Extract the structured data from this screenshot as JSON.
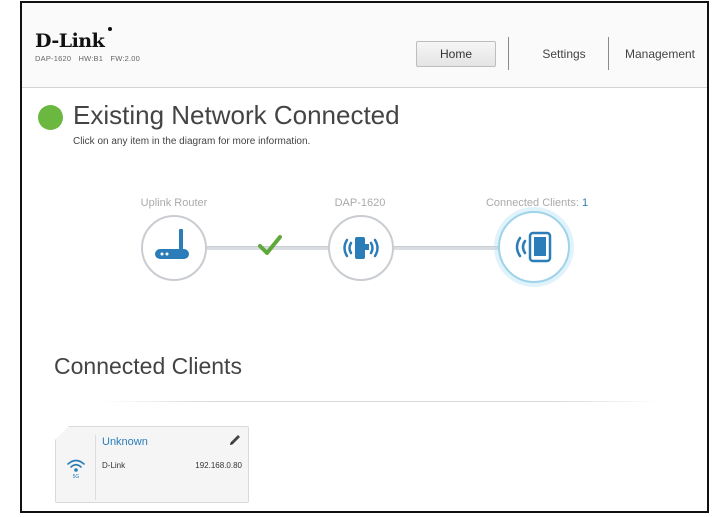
{
  "header": {
    "logo": "D-Link",
    "model": "DAP-1620",
    "hw": "HW:B1",
    "fw": "FW:2.00",
    "nav": {
      "home": "Home",
      "settings": "Settings",
      "management": "Management"
    }
  },
  "status": {
    "title": "Existing Network Connected",
    "subtitle": "Click on any item in the diagram for more information.",
    "color": "#6ab840"
  },
  "diagram": {
    "uplink_label": "Uplink Router",
    "device_label": "DAP-1620",
    "clients_label": "Connected Clients: ",
    "clients_count": "1",
    "uplink_icon": "router-icon",
    "device_icon": "extender-icon",
    "clients_icon": "tablet-wireless-icon",
    "link_status_icon": "check-icon"
  },
  "connected_clients": {
    "title": "Connected Clients",
    "clients": [
      {
        "name": "Unknown",
        "vendor": "D-Link",
        "ip": "192.168.0.80",
        "band": "5G",
        "icon": "wifi-5g-icon"
      }
    ]
  },
  "colors": {
    "accent_blue": "#2a7db8",
    "connected_green": "#6ab840",
    "client_ring": "#9fd3ea"
  }
}
